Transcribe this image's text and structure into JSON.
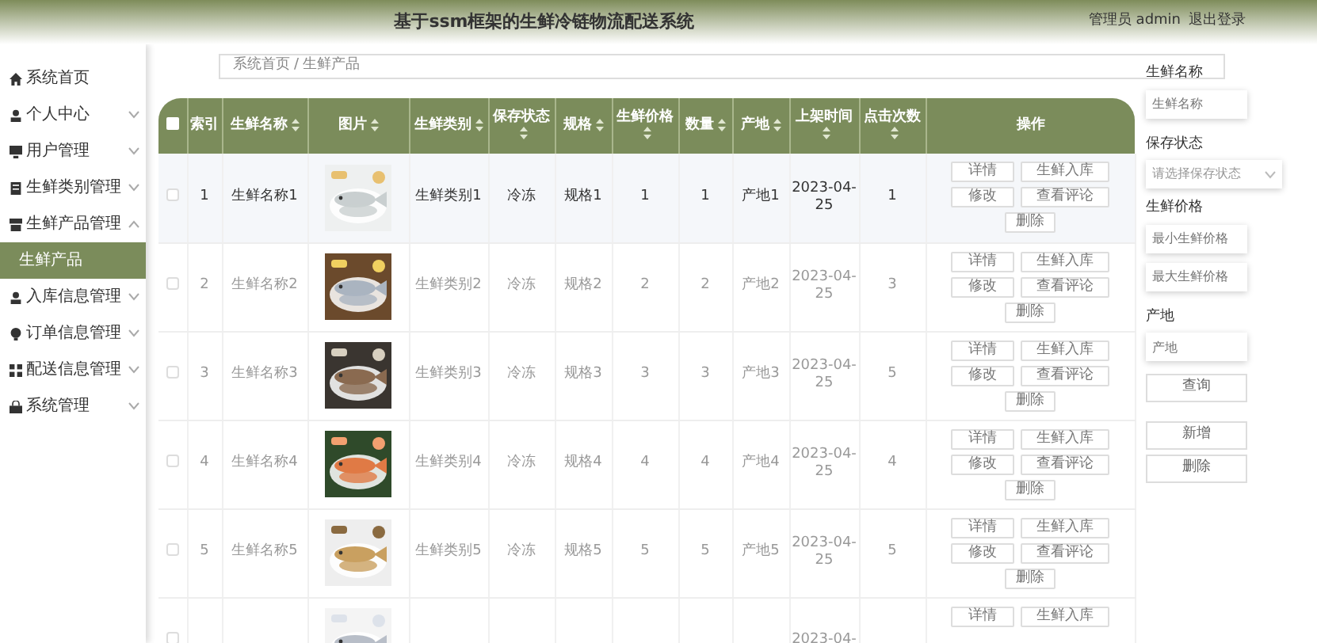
{
  "header": {
    "title": "基于ssm框架的生鲜冷链物流配送系统",
    "user": "管理员 admin",
    "logout": "退出登录"
  },
  "sidebar": {
    "items": [
      {
        "label": "系统首页",
        "expanded": false,
        "has_children": false,
        "selected": false
      },
      {
        "label": "个人中心",
        "expanded": false,
        "has_children": true,
        "selected": false
      },
      {
        "label": "用户管理",
        "expanded": false,
        "has_children": true,
        "selected": false
      },
      {
        "label": "生鲜类别管理",
        "expanded": false,
        "has_children": true,
        "selected": false
      },
      {
        "label": "生鲜产品管理",
        "expanded": true,
        "has_children": true,
        "selected": false,
        "children": [
          {
            "label": "生鲜产品",
            "selected": true
          }
        ]
      },
      {
        "label": "入库信息管理",
        "expanded": false,
        "has_children": true,
        "selected": false
      },
      {
        "label": "订单信息管理",
        "expanded": false,
        "has_children": true,
        "selected": false
      },
      {
        "label": "配送信息管理",
        "expanded": false,
        "has_children": true,
        "selected": false
      },
      {
        "label": "系统管理",
        "expanded": false,
        "has_children": true,
        "selected": false
      }
    ]
  },
  "breadcrumb": {
    "items": [
      "系统首页",
      "生鲜产品"
    ],
    "separator": "/"
  },
  "table": {
    "select_all_checked": false,
    "columns": [
      {
        "label": "索引",
        "sortable": false
      },
      {
        "label": "生鲜名称",
        "sortable": true
      },
      {
        "label": "图片",
        "sortable": true
      },
      {
        "label": "生鲜类别",
        "sortable": true
      },
      {
        "label": "保存状态",
        "sortable": true
      },
      {
        "label": "规格",
        "sortable": true
      },
      {
        "label": "生鲜价格",
        "sortable": true
      },
      {
        "label": "数量",
        "sortable": true
      },
      {
        "label": "产地",
        "sortable": true
      },
      {
        "label": "上架时间",
        "sortable": true
      },
      {
        "label": "点击次数",
        "sortable": true
      },
      {
        "label": "操作",
        "sortable": false
      }
    ],
    "rows": [
      {
        "checked": false,
        "hovered": true,
        "cells": [
          "1",
          "生鲜名称1",
          null,
          "生鲜类别1",
          "冷冻",
          "规格1",
          "1",
          "1",
          "产地1",
          "2023-04-25",
          "1"
        ],
        "picture": {
          "kind": "picture"
        },
        "actions": [
          "详情",
          "生鲜入库",
          "修改",
          "查看评论",
          "删除"
        ]
      },
      {
        "checked": false,
        "hovered": false,
        "cells": [
          "2",
          "生鲜名称2",
          null,
          "生鲜类别2",
          "冷冻",
          "规格2",
          "2",
          "2",
          "产地2",
          "2023-04-25",
          "3"
        ],
        "picture": {
          "kind": "picture"
        },
        "actions": [
          "详情",
          "生鲜入库",
          "修改",
          "查看评论",
          "删除"
        ]
      },
      {
        "checked": false,
        "hovered": false,
        "cells": [
          "3",
          "生鲜名称3",
          null,
          "生鲜类别3",
          "冷冻",
          "规格3",
          "3",
          "3",
          "产地3",
          "2023-04-25",
          "5"
        ],
        "picture": {
          "kind": "picture"
        },
        "actions": [
          "详情",
          "生鲜入库",
          "修改",
          "查看评论",
          "删除"
        ]
      },
      {
        "checked": false,
        "hovered": false,
        "cells": [
          "4",
          "生鲜名称4",
          null,
          "生鲜类别4",
          "冷冻",
          "规格4",
          "4",
          "4",
          "产地4",
          "2023-04-25",
          "4"
        ],
        "picture": {
          "kind": "picture"
        },
        "actions": [
          "详情",
          "生鲜入库",
          "修改",
          "查看评论",
          "删除"
        ]
      },
      {
        "checked": false,
        "hovered": false,
        "cells": [
          "5",
          "生鲜名称5",
          null,
          "生鲜类别5",
          "冷冻",
          "规格5",
          "5",
          "5",
          "产地5",
          "2023-04-25",
          "5"
        ],
        "picture": {
          "kind": "picture"
        },
        "actions": [
          "详情",
          "生鲜入库",
          "修改",
          "查看评论",
          "删除"
        ]
      },
      {
        "checked": false,
        "hovered": false,
        "cells": [
          null,
          null,
          null,
          null,
          null,
          null,
          null,
          null,
          null,
          "2023-04-",
          null
        ],
        "picture": {
          "kind": "picture"
        },
        "actions": [
          "详情",
          "生鲜入库"
        ]
      }
    ]
  },
  "search": {
    "fields": [
      {
        "label": "生鲜名称",
        "kind": "input",
        "placeholders": [
          "生鲜名称"
        ]
      },
      {
        "label": "保存状态",
        "kind": "select",
        "placeholders": [
          "请选择保存状态"
        ]
      },
      {
        "label": "生鲜价格",
        "kind": "input",
        "placeholders": [
          "最小生鲜价格",
          "最大生鲜价格"
        ]
      },
      {
        "label": "产地",
        "kind": "input",
        "placeholders": [
          "产地"
        ]
      }
    ],
    "query_button": "查询",
    "buttons": [
      "新增",
      "删除"
    ]
  }
}
